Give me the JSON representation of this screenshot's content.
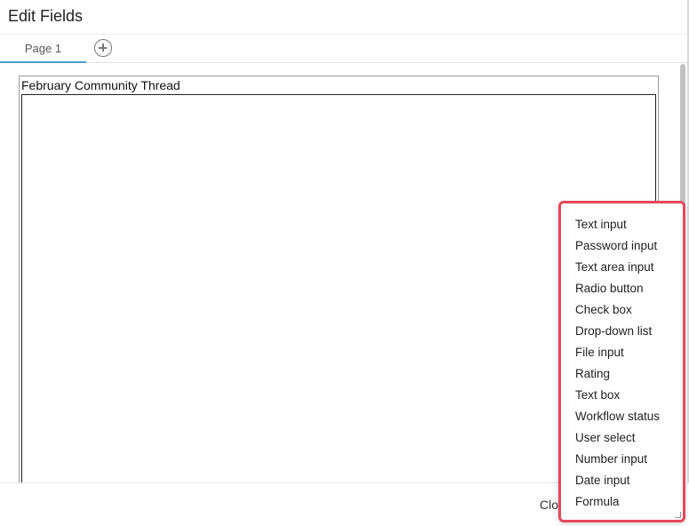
{
  "dialog": {
    "title": "Edit Fields"
  },
  "tabs": [
    {
      "label": "Page 1",
      "active": true
    }
  ],
  "add_page_icon": "plus-circle-icon",
  "canvas": {
    "title": "February Community Thread"
  },
  "footer": {
    "close_label": "Clo"
  },
  "field_menu": {
    "items": [
      "Text input",
      "Password input",
      "Text area input",
      "Radio button",
      "Check box",
      "Drop-down list",
      "File input",
      "Rating",
      "Text box",
      "Workflow status",
      "User select",
      "Number input",
      "Date input",
      "Formula"
    ]
  },
  "colors": {
    "tab_active_underline": "#4aa0c8",
    "menu_highlight_border": "#e8485b"
  }
}
